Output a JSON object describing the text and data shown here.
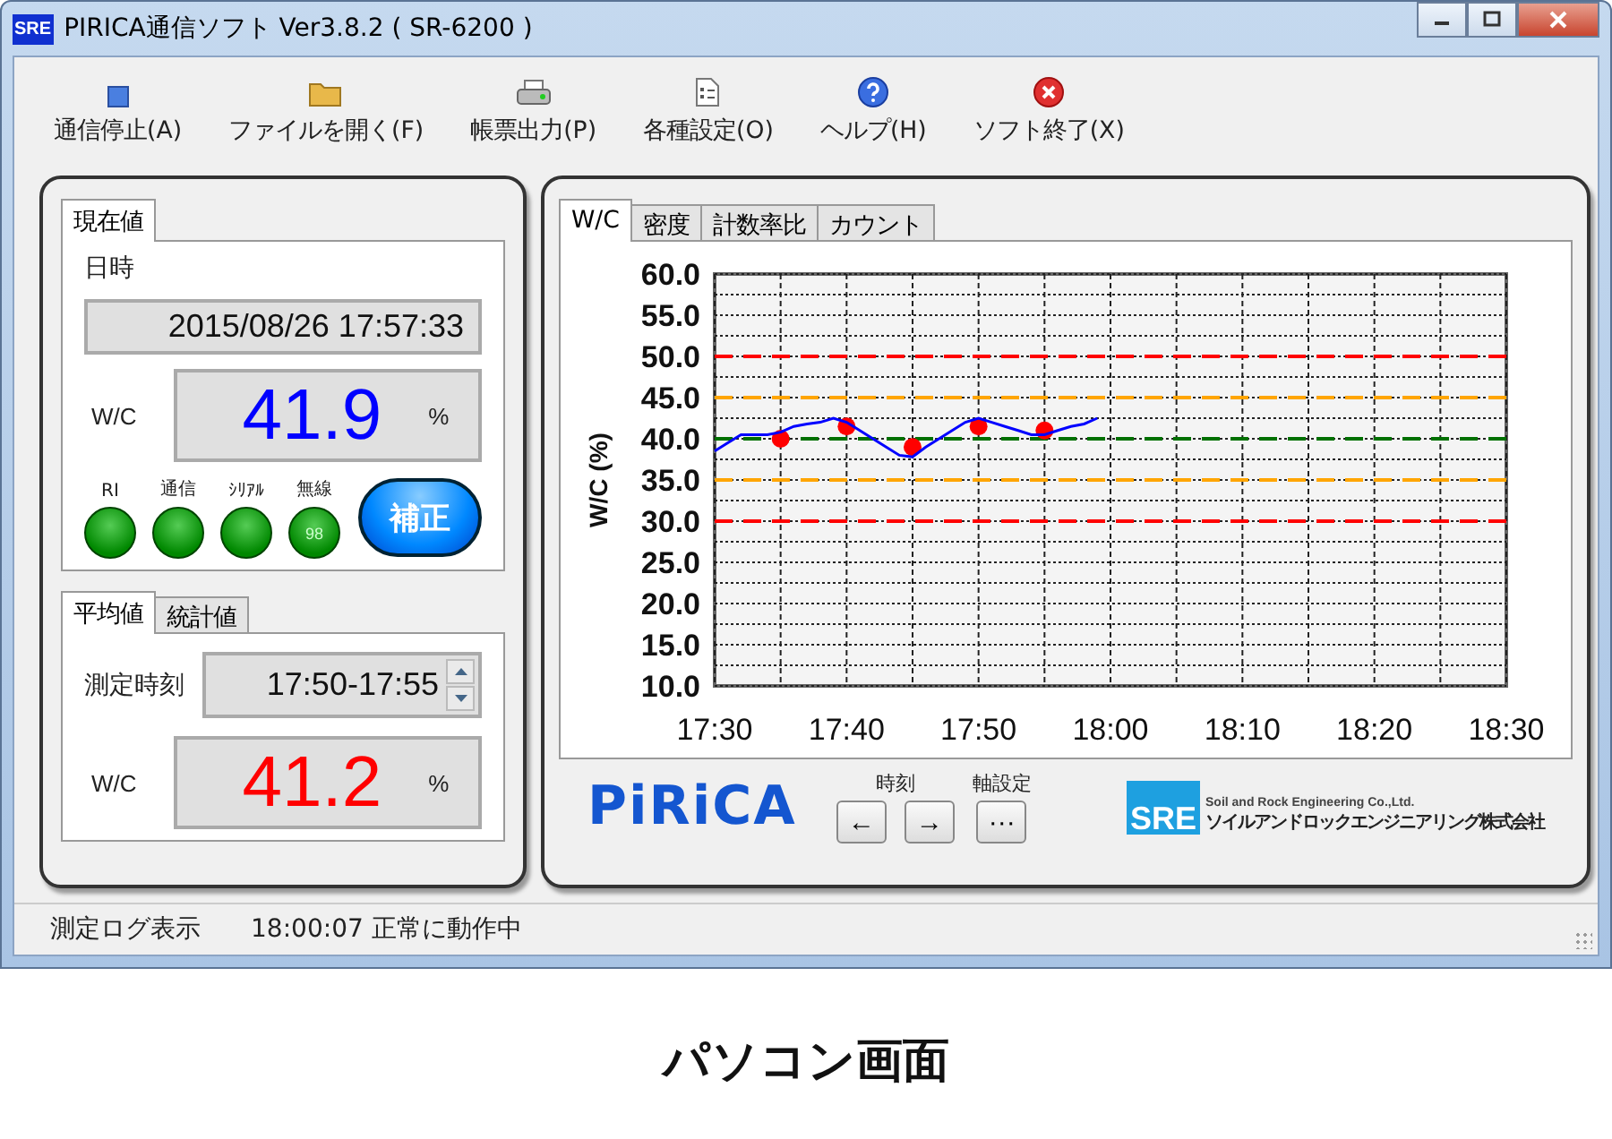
{
  "window": {
    "app_icon": "SRE",
    "title": "PIRICA通信ソフト Ver3.8.2 ( SR-6200 )"
  },
  "toolbar": [
    {
      "kind": "stop",
      "label": "通信停止(A)"
    },
    {
      "kind": "folder",
      "label": "ファイルを開く(F)"
    },
    {
      "kind": "printer",
      "label": "帳票出力(P)"
    },
    {
      "kind": "settings",
      "label": "各種設定(O)"
    },
    {
      "kind": "help",
      "label": "ヘルプ(H)"
    },
    {
      "kind": "exit",
      "label": "ソフト終了(X)"
    }
  ],
  "current": {
    "tabs": [
      {
        "label": "現在値",
        "selected": true
      }
    ],
    "datetime_label": "日時",
    "datetime": "2015/08/26 17:57:33",
    "wc_label": "W/C",
    "wc_value": "41.9",
    "unit": "%",
    "lamps": [
      {
        "label": "RI"
      },
      {
        "label": "通信"
      },
      {
        "label": "ｼﾘｱﾙ"
      },
      {
        "label": "無線",
        "reading": "98"
      }
    ],
    "button": "補正"
  },
  "average": {
    "tabs": [
      {
        "label": "平均値",
        "selected": true
      },
      {
        "label": "統計値",
        "selected": false
      }
    ],
    "period_label": "測定時刻",
    "period": "17:50-17:55",
    "wc_label": "W/C",
    "wc_value": "41.2",
    "unit": "%"
  },
  "chart_panel": {
    "tabs": [
      {
        "label": "W/C",
        "selected": true
      },
      {
        "label": "密度",
        "selected": false
      },
      {
        "label": "計数率比",
        "selected": false
      },
      {
        "label": "カウント",
        "selected": false
      }
    ],
    "chart_data": {
      "type": "line",
      "ylabel": "W/C (%)",
      "categories": [
        "17:30",
        null,
        null,
        null,
        null,
        null,
        null,
        null,
        null,
        null,
        "17:40",
        null,
        null,
        null,
        null,
        null,
        null,
        null,
        null,
        null,
        "17:50",
        null,
        null,
        null,
        null,
        null,
        null,
        null,
        null,
        null,
        "18:00",
        null,
        null,
        null,
        null,
        null,
        null,
        null,
        null,
        null,
        "18:10",
        null,
        null,
        null,
        null,
        null,
        null,
        null,
        null,
        null,
        "18:20",
        null,
        null,
        null,
        null,
        null,
        null,
        null,
        null,
        null,
        "18:30"
      ],
      "series": [
        {
          "color": "#0000ff",
          "values": [
            38.5,
            39.5,
            40.5,
            40.5,
            40.5,
            40.8,
            41.5,
            41.8,
            42.0,
            42.5,
            42.0,
            41.0,
            40.0,
            39.0,
            38.0,
            37.8,
            39.0,
            40.0,
            41.0,
            42.0,
            42.5,
            42.0,
            41.5,
            41.0,
            40.5,
            40.5,
            41.0,
            41.5,
            41.8,
            42.5,
            null,
            null,
            null,
            null,
            null,
            null,
            null,
            null,
            null,
            null,
            null,
            null,
            null,
            null,
            null,
            null,
            null,
            null,
            null,
            null,
            null,
            null,
            null,
            null,
            null,
            null,
            null,
            null,
            null,
            null,
            null
          ]
        },
        {
          "type": "scatter",
          "color": "#ff0000",
          "values": [
            null,
            null,
            null,
            null,
            null,
            40.0,
            null,
            null,
            null,
            null,
            41.5,
            null,
            null,
            null,
            null,
            39.0,
            null,
            null,
            null,
            null,
            41.5,
            null,
            null,
            null,
            null,
            41.0,
            null,
            null,
            null,
            null,
            null,
            null,
            null,
            null,
            null,
            null,
            null,
            null,
            null,
            null,
            null,
            null,
            null,
            null,
            null,
            null,
            null,
            null,
            null,
            null,
            null,
            null,
            null,
            null,
            null,
            null,
            null,
            null,
            null,
            null,
            null
          ]
        },
        {
          "type": "line",
          "line_style": "dashed",
          "color": "#ff0000",
          "values": [
            50,
            50,
            50,
            50,
            50,
            50,
            50,
            50,
            50,
            50,
            50,
            50,
            50,
            50,
            50,
            50,
            50,
            50,
            50,
            50,
            50,
            50,
            50,
            50,
            50,
            50,
            50,
            50,
            50,
            50,
            50,
            50,
            50,
            50,
            50,
            50,
            50,
            50,
            50,
            50,
            50,
            50,
            50,
            50,
            50,
            50,
            50,
            50,
            50,
            50,
            50,
            50,
            50,
            50,
            50,
            50,
            50,
            50,
            50,
            50,
            50
          ]
        },
        {
          "type": "line",
          "line_style": "dashed",
          "color": "#ffa500",
          "values": [
            45,
            45,
            45,
            45,
            45,
            45,
            45,
            45,
            45,
            45,
            45,
            45,
            45,
            45,
            45,
            45,
            45,
            45,
            45,
            45,
            45,
            45,
            45,
            45,
            45,
            45,
            45,
            45,
            45,
            45,
            45,
            45,
            45,
            45,
            45,
            45,
            45,
            45,
            45,
            45,
            45,
            45,
            45,
            45,
            45,
            45,
            45,
            45,
            45,
            45,
            45,
            45,
            45,
            45,
            45,
            45,
            45,
            45,
            45,
            45,
            45
          ]
        },
        {
          "type": "line",
          "line_style": "dashed",
          "color": "#007000",
          "values": [
            40,
            40,
            40,
            40,
            40,
            40,
            40,
            40,
            40,
            40,
            40,
            40,
            40,
            40,
            40,
            40,
            40,
            40,
            40,
            40,
            40,
            40,
            40,
            40,
            40,
            40,
            40,
            40,
            40,
            40,
            40,
            40,
            40,
            40,
            40,
            40,
            40,
            40,
            40,
            40,
            40,
            40,
            40,
            40,
            40,
            40,
            40,
            40,
            40,
            40,
            40,
            40,
            40,
            40,
            40,
            40,
            40,
            40,
            40,
            40,
            40
          ]
        },
        {
          "type": "line",
          "line_style": "dashed",
          "color": "#ffa500",
          "values": [
            35,
            35,
            35,
            35,
            35,
            35,
            35,
            35,
            35,
            35,
            35,
            35,
            35,
            35,
            35,
            35,
            35,
            35,
            35,
            35,
            35,
            35,
            35,
            35,
            35,
            35,
            35,
            35,
            35,
            35,
            35,
            35,
            35,
            35,
            35,
            35,
            35,
            35,
            35,
            35,
            35,
            35,
            35,
            35,
            35,
            35,
            35,
            35,
            35,
            35,
            35,
            35,
            35,
            35,
            35,
            35,
            35,
            35,
            35,
            35,
            35
          ]
        },
        {
          "type": "line",
          "line_style": "dashed",
          "color": "#ff0000",
          "values": [
            30,
            30,
            30,
            30,
            30,
            30,
            30,
            30,
            30,
            30,
            30,
            30,
            30,
            30,
            30,
            30,
            30,
            30,
            30,
            30,
            30,
            30,
            30,
            30,
            30,
            30,
            30,
            30,
            30,
            30,
            30,
            30,
            30,
            30,
            30,
            30,
            30,
            30,
            30,
            30,
            30,
            30,
            30,
            30,
            30,
            30,
            30,
            30,
            30,
            30,
            30,
            30,
            30,
            30,
            30,
            30,
            30,
            30,
            30,
            30,
            30
          ]
        }
      ],
      "ylim": [
        10,
        60
      ],
      "yticks": [
        {
          "value": 60,
          "label": "60.0"
        },
        {
          "value": 55,
          "label": "55.0"
        },
        {
          "value": 50,
          "label": "50.0"
        },
        {
          "value": 45,
          "label": "45.0"
        },
        {
          "value": 40,
          "label": "40.0"
        },
        {
          "value": 35,
          "label": "35.0"
        },
        {
          "value": 30,
          "label": "30.0"
        },
        {
          "value": 25,
          "label": "25.0"
        },
        {
          "value": 20,
          "label": "20.0"
        },
        {
          "value": 15,
          "label": "15.0"
        },
        {
          "value": 10,
          "label": "10.0"
        }
      ],
      "grid": true
    },
    "logo": "PiRiCA",
    "nav": [
      {
        "label": "時刻",
        "buttons": [
          "←",
          "→"
        ]
      },
      {
        "label": "軸設定",
        "buttons": [
          "···"
        ]
      }
    ],
    "company": {
      "mark": "SRE",
      "name_en": "Soil and Rock Engineering Co.,Ltd.",
      "name_ja": "ソイルアンドロックエンジニアリング株式会社"
    }
  },
  "status_bar": [
    "測定ログ表示",
    "18:00:07 正常に動作中"
  ],
  "caption": "パソコン画面"
}
